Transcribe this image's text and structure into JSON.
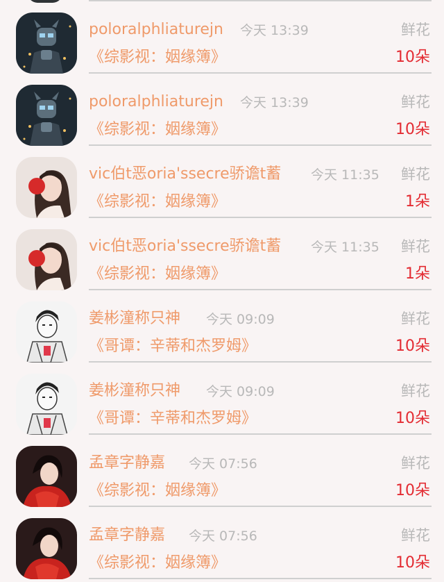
{
  "gift_records": [
    {
      "avatar": "robot-avatar",
      "name": "poloralphliaturejn",
      "time": "今天 13:39",
      "gift_label": "鲜花",
      "book_title": "《综影视：姻缘簿》",
      "count": "10朵"
    },
    {
      "avatar": "robot-avatar",
      "name": "poloralphliaturejn",
      "time": "今天 13:39",
      "gift_label": "鲜花",
      "book_title": "《综影视：姻缘簿》",
      "count": "10朵"
    },
    {
      "avatar": "girl-red-cup-avatar",
      "name": "vic伯t恶oria'ssecre骄谵t蓄",
      "time": "今天 11:35",
      "gift_label": "鲜花",
      "book_title": "《综影视：姻缘簿》",
      "count": "1朵"
    },
    {
      "avatar": "girl-red-cup-avatar",
      "name": "vic伯t恶oria'ssecre骄谵t蓄",
      "time": "今天 11:35",
      "gift_label": "鲜花",
      "book_title": "《综影视：姻缘簿》",
      "count": "1朵"
    },
    {
      "avatar": "boy-sketch-avatar",
      "name": "姜彬潼称只神",
      "time": "今天 09:09",
      "gift_label": "鲜花",
      "book_title": "《哥谭：辛蒂和杰罗姆》",
      "count": "10朵"
    },
    {
      "avatar": "boy-sketch-avatar",
      "name": "姜彬潼称只神",
      "time": "今天 09:09",
      "gift_label": "鲜花",
      "book_title": "《哥谭：辛蒂和杰罗姆》",
      "count": "10朵"
    },
    {
      "avatar": "woman-red-dress-avatar",
      "name": "孟章字静嘉",
      "time": "今天 07:56",
      "gift_label": "鲜花",
      "book_title": "《综影视：姻缘簿》",
      "count": "10朵"
    },
    {
      "avatar": "woman-red-dress-avatar",
      "name": "孟章字静嘉",
      "time": "今天 07:56",
      "gift_label": "鲜花",
      "book_title": "《综影视：姻缘簿》",
      "count": "10朵"
    }
  ],
  "colors": {
    "accent_orange": "#ef9a6a",
    "count_red": "#e32b32",
    "muted_gray": "#b8b8b8",
    "background": "#f9f4f4"
  }
}
